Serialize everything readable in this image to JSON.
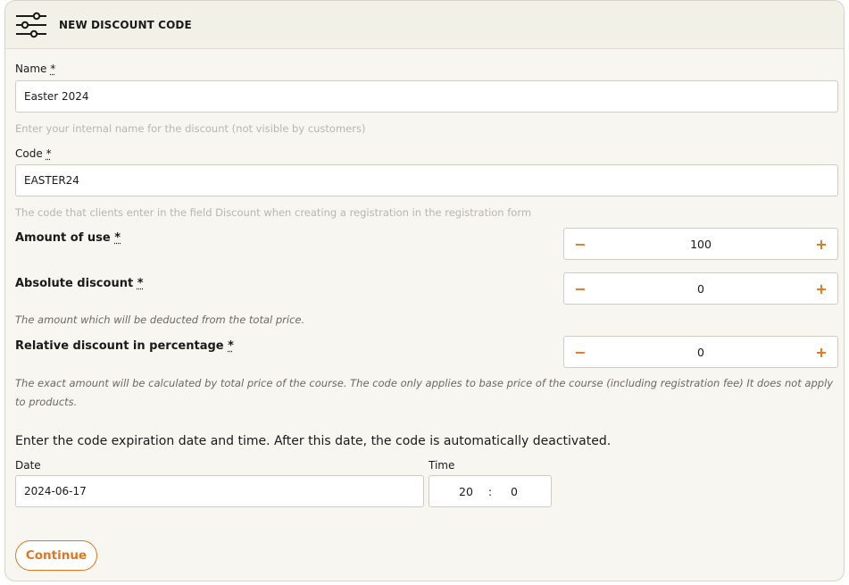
{
  "header": {
    "title": "NEW DISCOUNT CODE",
    "icon": "sliders-icon"
  },
  "name_field": {
    "label": "Name",
    "required_mark": "*",
    "value": "Easter 2024",
    "help": "Enter your internal name for the discount (not visible by customers)"
  },
  "code_field": {
    "label": "Code",
    "required_mark": "*",
    "value": "EASTER24",
    "help": "The code that clients enter in the field Discount when creating a registration in the registration form"
  },
  "amount_of_use": {
    "label": "Amount of use",
    "required_mark": "*",
    "value": "100",
    "minus": "−",
    "plus": "+"
  },
  "absolute_discount": {
    "label": "Absolute discount",
    "required_mark": "*",
    "value": "0",
    "minus": "−",
    "plus": "+",
    "help": "The amount which will be deducted from the total price."
  },
  "relative_discount": {
    "label": "Relative discount in percentage",
    "required_mark": "*",
    "value": "0",
    "minus": "−",
    "plus": "+",
    "help": "The exact amount will be calculated by total price of the course. The code only applies to base price of the course (including registration fee) It does not apply to products."
  },
  "expiration": {
    "text": "Enter the code expiration date and time. After this date, the code is automatically deactivated.",
    "date_label": "Date",
    "date_value": "2024-06-17",
    "time_label": "Time",
    "hour": "20",
    "separator": ":",
    "minute": "0"
  },
  "continue_label": "Continue",
  "colors": {
    "accent": "#e8731a",
    "card_bg": "#f7f6f0",
    "header_bg": "#f2f1e8"
  }
}
